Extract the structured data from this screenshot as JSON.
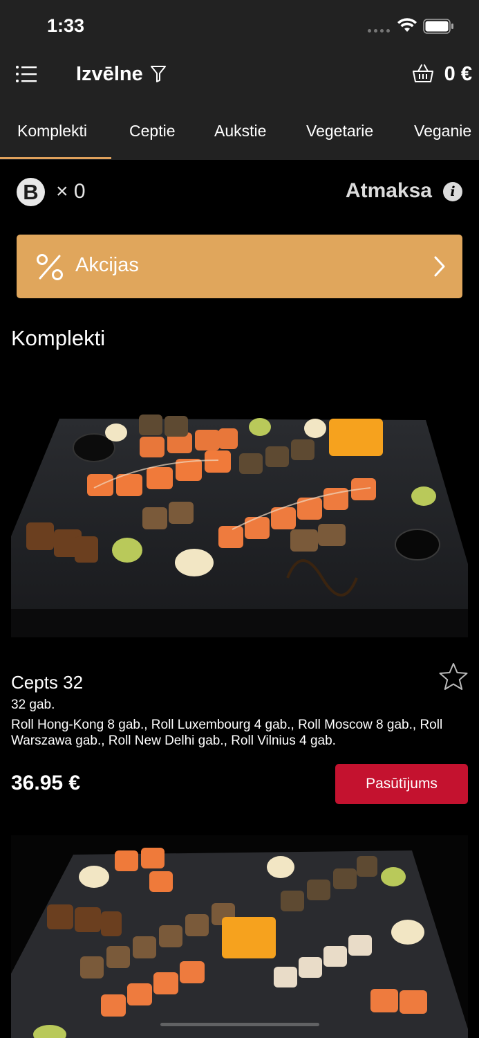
{
  "status_bar": {
    "time": "1:33"
  },
  "header": {
    "title": "Izvēlne",
    "cart_total": "0 €"
  },
  "tabs": [
    {
      "label": "Komplekti",
      "active": true
    },
    {
      "label": "Ceptie"
    },
    {
      "label": "Aukstie"
    },
    {
      "label": "Vegetarie"
    },
    {
      "label": "Veganie"
    }
  ],
  "bonus": {
    "badge": "B",
    "count": "× 0",
    "refund_label": "Atmaksa",
    "info_glyph": "i"
  },
  "promo": {
    "label": "Akcijas",
    "color": "#e0a65c"
  },
  "section": {
    "title": "Komplekti"
  },
  "products": [
    {
      "name": "Cepts 32",
      "qty": "32 gab.",
      "description": "Roll Hong-Kong 8 gab., Roll Luxembourg 4 gab., Roll Moscow 8 gab., Roll Warszawa gab., Roll New Delhi gab., Roll Vilnius 4 gab.",
      "price": "36.95 €",
      "order_label": "Pasūtījums"
    }
  ],
  "colors": {
    "accent": "#e0a15c",
    "order_button": "#c4122f",
    "header_bg": "#222222"
  }
}
